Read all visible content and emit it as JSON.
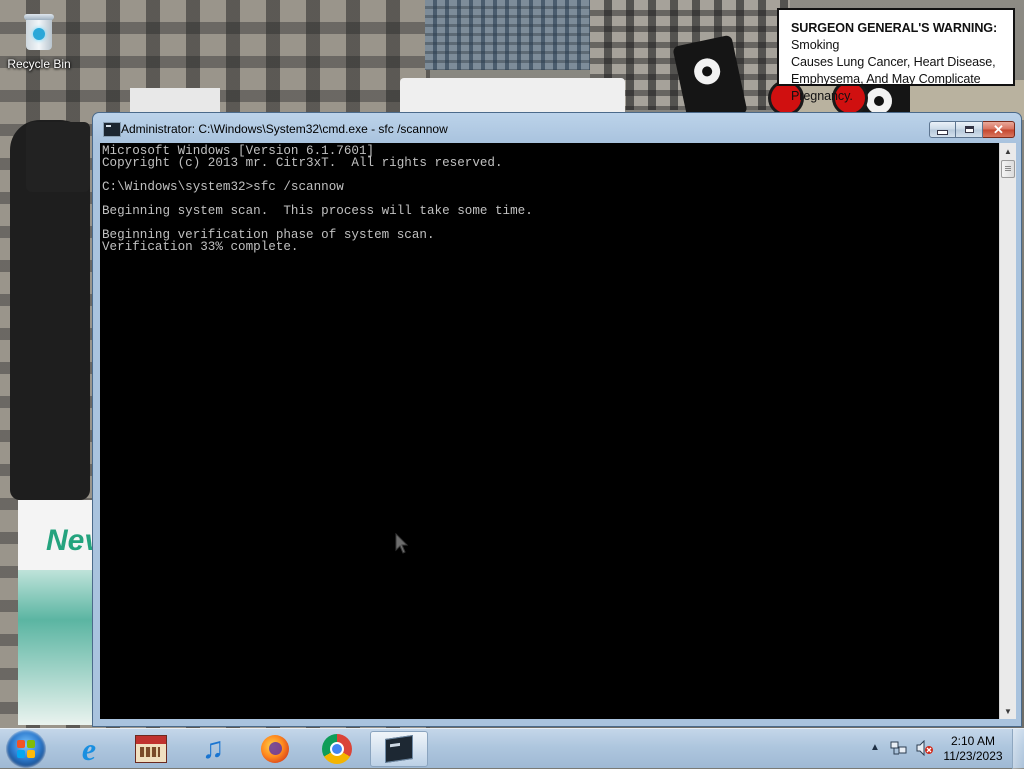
{
  "desktop": {
    "recycle_bin_label": "Recycle Bin",
    "warning_label": {
      "bold": "SURGEON GENERAL'S WARNING:",
      "rest_line1": " Smoking",
      "line2": "Causes Lung Cancer, Heart Disease,",
      "line3": "Emphysema, And May Complicate Pregnancy."
    },
    "pack_logo": "Nev"
  },
  "window": {
    "title": "Administrator: C:\\Windows\\System32\\cmd.exe - sfc  /scannow",
    "minimize_icon": "minimize-icon",
    "maximize_icon": "maximize-icon",
    "close_label": "✕",
    "console_text": "Microsoft Windows [Version 6.1.7601]\nCopyright (c) 2013 mr. Citr3xT.  All rights reserved.\n\nC:\\Windows\\system32>sfc /scannow\n\nBeginning system scan.  This process will take some time.\n\nBeginning verification phase of system scan.\nVerification 33% complete.",
    "verification_progress_percent": 33
  },
  "taskbar": {
    "start_icon": "windows-start-orb-icon",
    "pinned": [
      {
        "name": "internet-explorer-icon",
        "glyph": "e"
      },
      {
        "name": "library-app-icon"
      },
      {
        "name": "itunes-icon",
        "glyph": "♫"
      },
      {
        "name": "firefox-icon"
      },
      {
        "name": "chrome-icon"
      },
      {
        "name": "cmd-icon",
        "active": true
      }
    ],
    "tray": {
      "expand_arrow": "▲",
      "time": "2:10 AM",
      "date": "11/23/2023"
    }
  },
  "colors": {
    "console_background": "#000000",
    "console_text": "#c0c0c0",
    "title_bar": "#a9c3de",
    "close_button": "#c4452c",
    "taskbar": "#aec6de"
  }
}
